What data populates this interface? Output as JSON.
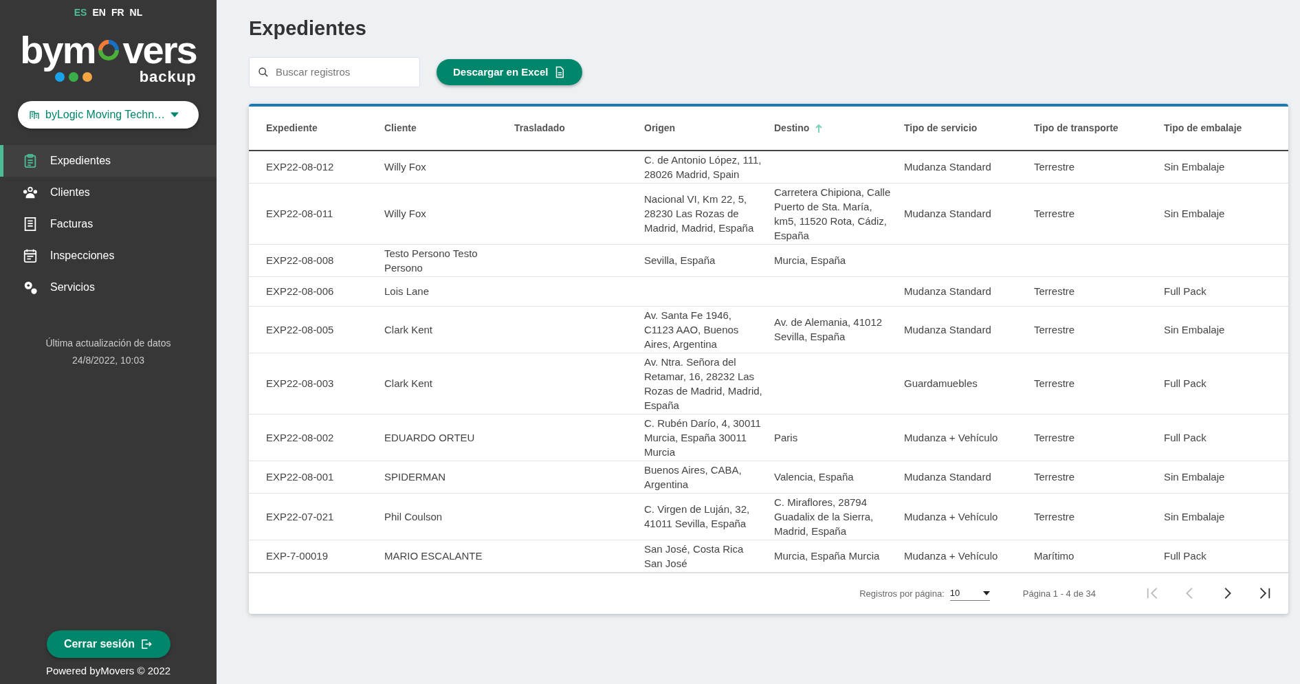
{
  "languages": [
    {
      "label": "ES",
      "selected": true
    },
    {
      "label": "EN",
      "selected": false
    },
    {
      "label": "FR",
      "selected": false
    },
    {
      "label": "NL",
      "selected": false
    }
  ],
  "logo": {
    "before": "bym",
    "after": "vers",
    "subtitle": "backup"
  },
  "company_selector": {
    "value": "byLogic Moving Techn…"
  },
  "sidebar": {
    "items": [
      {
        "label": "Expedientes",
        "selected": true
      },
      {
        "label": "Clientes",
        "selected": false
      },
      {
        "label": "Facturas",
        "selected": false
      },
      {
        "label": "Inspecciones",
        "selected": false
      },
      {
        "label": "Servicios",
        "selected": false
      }
    ],
    "update_label": "Última actualización de datos",
    "update_time": "24/8/2022, 10:03",
    "logout": "Cerrar sesión",
    "footer": "Powered byMovers © 2022"
  },
  "page_title": "Expedientes",
  "search": {
    "placeholder": "Buscar registros"
  },
  "export_button": "Descargar en Excel",
  "table": {
    "columns": [
      {
        "label": "Expediente",
        "sorted": false
      },
      {
        "label": "Cliente",
        "sorted": false
      },
      {
        "label": "Trasladado",
        "sorted": false
      },
      {
        "label": "Origen",
        "sorted": false
      },
      {
        "label": "Destino",
        "sorted": true
      },
      {
        "label": "Tipo de servicio",
        "sorted": false
      },
      {
        "label": "Tipo de transporte",
        "sorted": false
      },
      {
        "label": "Tipo de embalaje",
        "sorted": false
      }
    ],
    "rows": [
      [
        "EXP22-08-012",
        "Willy Fox",
        "",
        "C. de Antonio López, 111, 28026 Madrid, Spain",
        "",
        "Mudanza Standard",
        "Terrestre",
        "Sin Embalaje"
      ],
      [
        "EXP22-08-011",
        "Willy Fox",
        "",
        "Nacional VI, Km 22, 5, 28230 Las Rozas de Madrid, Madrid, España",
        "Carretera Chipiona, Calle Puerto de Sta. María, km5, 11520 Rota, Cádiz, España",
        "Mudanza Standard",
        "Terrestre",
        "Sin Embalaje"
      ],
      [
        "EXP22-08-008",
        "Testo Persono Testo Persono",
        "",
        "Sevilla, España",
        "Murcia, España",
        "",
        "",
        ""
      ],
      [
        "EXP22-08-006",
        "Lois Lane",
        "",
        "",
        "",
        "Mudanza Standard",
        "Terrestre",
        "Full Pack"
      ],
      [
        "EXP22-08-005",
        "Clark Kent",
        "",
        "Av. Santa Fe 1946, C1123 AAO, Buenos Aires, Argentina",
        "Av. de Alemania, 41012 Sevilla, España",
        "Mudanza Standard",
        "Terrestre",
        "Sin Embalaje"
      ],
      [
        "EXP22-08-003",
        "Clark Kent",
        "",
        "Av. Ntra. Señora del Retamar, 16, 28232 Las Rozas de Madrid, Madrid, España",
        "",
        "Guardamuebles",
        "Terrestre",
        "Full Pack"
      ],
      [
        "EXP22-08-002",
        "EDUARDO ORTEU",
        "",
        "C. Rubén Darío, 4, 30011 Murcia, España 30011 Murcia",
        "Paris",
        "Mudanza + Vehículo",
        "Terrestre",
        "Full Pack"
      ],
      [
        "EXP22-08-001",
        "SPIDERMAN",
        "",
        "Buenos Aires, CABA, Argentina",
        "Valencia, España",
        "Mudanza Standard",
        "Terrestre",
        "Sin Embalaje"
      ],
      [
        "EXP22-07-021",
        "Phil Coulson",
        "",
        "C. Virgen de Luján, 32, 41011 Sevilla, España",
        "C. Miraflores, 28794 Guadalix de la Sierra, Madrid, España",
        "Mudanza + Vehículo",
        "Terrestre",
        "Sin Embalaje"
      ],
      [
        "EXP-7-00019",
        "MARIO ESCALANTE",
        "",
        "San José, Costa Rica San José",
        "Murcia, España Murcia",
        "Mudanza + Vehículo",
        "Marítimo",
        "Full Pack"
      ]
    ]
  },
  "pagination": {
    "per_page_label": "Registros por página:",
    "per_page": "10",
    "range": "Página 1 - 4 de 34",
    "buttons": [
      {
        "kind": "first",
        "disabled": true
      },
      {
        "kind": "prev",
        "disabled": true
      },
      {
        "kind": "next",
        "disabled": false
      },
      {
        "kind": "last",
        "disabled": false
      }
    ]
  }
}
